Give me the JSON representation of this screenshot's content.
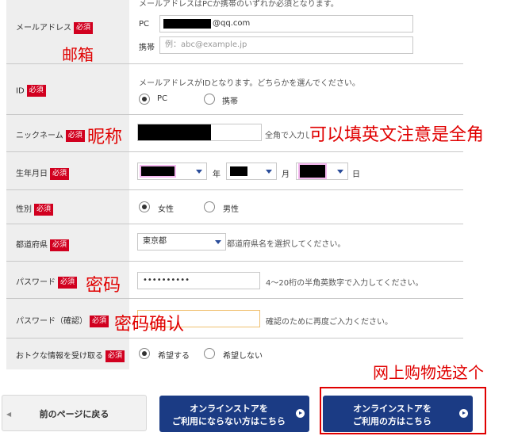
{
  "form": {
    "email": {
      "label": "メールアドレス",
      "required": "必須",
      "note": "メールアドレスはPCか携帯のいずれか必須となります。",
      "pc_label": "PC",
      "pc_value": "@qq.com",
      "mobile_label": "携帯",
      "mobile_placeholder": "例：abc@example.jp"
    },
    "id": {
      "label": "ID",
      "required": "必須",
      "note": "メールアドレスがIDとなります。どちらかを選んでください。",
      "options": [
        "PC",
        "携帯"
      ],
      "selected": "PC"
    },
    "nickname": {
      "label": "ニックネーム",
      "required": "必須",
      "note": "全角で入力してください。"
    },
    "birthday": {
      "label": "生年月日",
      "required": "必須",
      "year_suffix": "年",
      "month_suffix": "月",
      "day_suffix": "日"
    },
    "gender": {
      "label": "性別",
      "required": "必須",
      "options": [
        "女性",
        "男性"
      ],
      "selected": "女性"
    },
    "prefecture": {
      "label": "都道府県",
      "required": "必須",
      "value": "東京都",
      "note": "都道府県名を選択してください。"
    },
    "password": {
      "label": "パスワード",
      "required": "必須",
      "value": "••••••••••",
      "note": "4～20桁の半角英数字で入力してください。"
    },
    "password_confirm": {
      "label": "パスワード（確認）",
      "required": "必須",
      "note": "確認のために再度ご入力ください。"
    },
    "newsletter": {
      "label": "おトクな情報を受け取る",
      "required": "必須",
      "options": [
        "希望する",
        "希望しない"
      ],
      "selected": "希望する"
    }
  },
  "annotations": {
    "email": "邮箱",
    "nickname": "昵称",
    "nickname_hint": "可以填英文注意是全角",
    "password": "密码",
    "password_confirm": "密码确认",
    "online_store": "网上购物选这个"
  },
  "buttons": {
    "back": "前のページに戻る",
    "no_store_line1": "オンラインストアを",
    "no_store_line2": "ご利用にならない方はこちら",
    "store_line1": "オンラインストアを",
    "store_line2": "ご利用の方はこちら"
  },
  "colors": {
    "required_badge": "#d1001f",
    "button_blue": "#1b3b84",
    "annotation_red": "#e00000"
  }
}
